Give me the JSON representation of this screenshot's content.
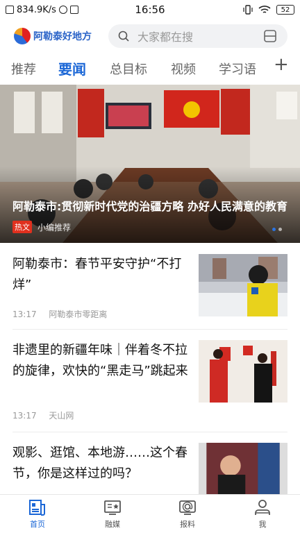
{
  "status_bar": {
    "speed": "834.9K/s",
    "time": "16:56",
    "battery": "52"
  },
  "header": {
    "app_name": "阿勒泰好地方",
    "search_placeholder": "大家都在搜"
  },
  "tabs": [
    {
      "label": "推荐",
      "active": false
    },
    {
      "label": "要闻",
      "active": true
    },
    {
      "label": "总目标",
      "active": false
    },
    {
      "label": "视频",
      "active": false
    },
    {
      "label": "学习语",
      "active": false
    }
  ],
  "tab_add_label": "+",
  "hero": {
    "title": "阿勒泰市:贯彻新时代党的治疆方略 办好人民满意的教育",
    "badge": "热文",
    "source": "小编推荐"
  },
  "news": [
    {
      "title": "阿勒泰市：春节平安守护“不打烊”",
      "time": "13:17",
      "source": "阿勒泰市零距离"
    },
    {
      "title": "非遗里的新疆年味｜伴着冬不拉的旋律，欢快的“黑走马”跳起来",
      "time": "13:17",
      "source": "天山网"
    },
    {
      "title": "观影、逛馆、本地游……这个春节，你是这样过的吗？",
      "time": "",
      "source": ""
    }
  ],
  "bottom_nav": [
    {
      "label": "首页",
      "icon": "news-home-icon",
      "active": true
    },
    {
      "label": "融媒",
      "icon": "media-icon",
      "active": false
    },
    {
      "label": "报料",
      "icon": "report-icon",
      "active": false
    },
    {
      "label": "我",
      "icon": "user-icon",
      "active": false
    }
  ],
  "colors": {
    "accent": "#1a66d6",
    "hot_badge": "#e0301e",
    "logo_text": "#2a63c8"
  }
}
